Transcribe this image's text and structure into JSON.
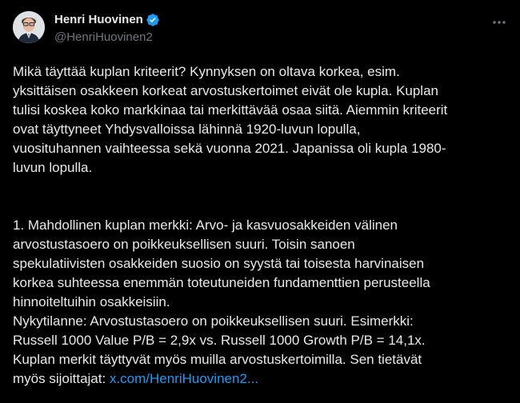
{
  "author": {
    "display_name": "Henri Huovinen",
    "handle": "@HenriHuovinen2",
    "verified": true
  },
  "icons": {
    "verified": "verified-badge-icon",
    "more": "more-options-icon"
  },
  "colors": {
    "background": "#000000",
    "text": "#e7e9ea",
    "secondary_text": "#71767b",
    "link": "#1d9bf0",
    "verified_badge": "#1d9bf0"
  },
  "tweet": {
    "paragraph_1_lines": [
      "Mikä täyttää kuplan kriteerit? Kynnyksen on oltava korkea, esim.",
      "yksittäisen osakkeen korkeat arvostuskertoimet eivät ole kupla. Kuplan",
      "tulisi koskea koko markkinaa tai merkittävää osaa siitä. Aiemmin kriteerit",
      "ovat täyttyneet Yhdysvalloissa lähinnä 1920-luvun lopulla,",
      "vuosituhannen vaihteessa sekä vuonna 2021. Japanissa oli kupla 1980-",
      "luvun lopulla."
    ],
    "paragraph_2_lines": [
      "1. Mahdollinen kuplan merkki: Arvo- ja kasvuosakkeiden välinen",
      "arvostustasoero on poikkeuksellisen suuri. Toisin sanoen",
      "spekulatiivisten osakkeiden suosio on syystä tai toisesta harvinaisen",
      "korkea suhteessa enemmän toteutuneiden fundamenttien perusteella",
      "hinnoiteltuihin osakkeisiin.",
      "Nykytilanne: Arvostustasoero on poikkeuksellisen suuri. Esimerkki:",
      "Russell 1000 Value P/B = 2,9x vs. Russell 1000 Growth P/B = 14,1x.",
      "Kuplan merkit täyttyvät myös muilla arvostuskertoimilla. Sen tietävät"
    ],
    "last_line_prefix": "myös sijoittajat: ",
    "link_text": "x.com/HenriHuovinen2..."
  }
}
